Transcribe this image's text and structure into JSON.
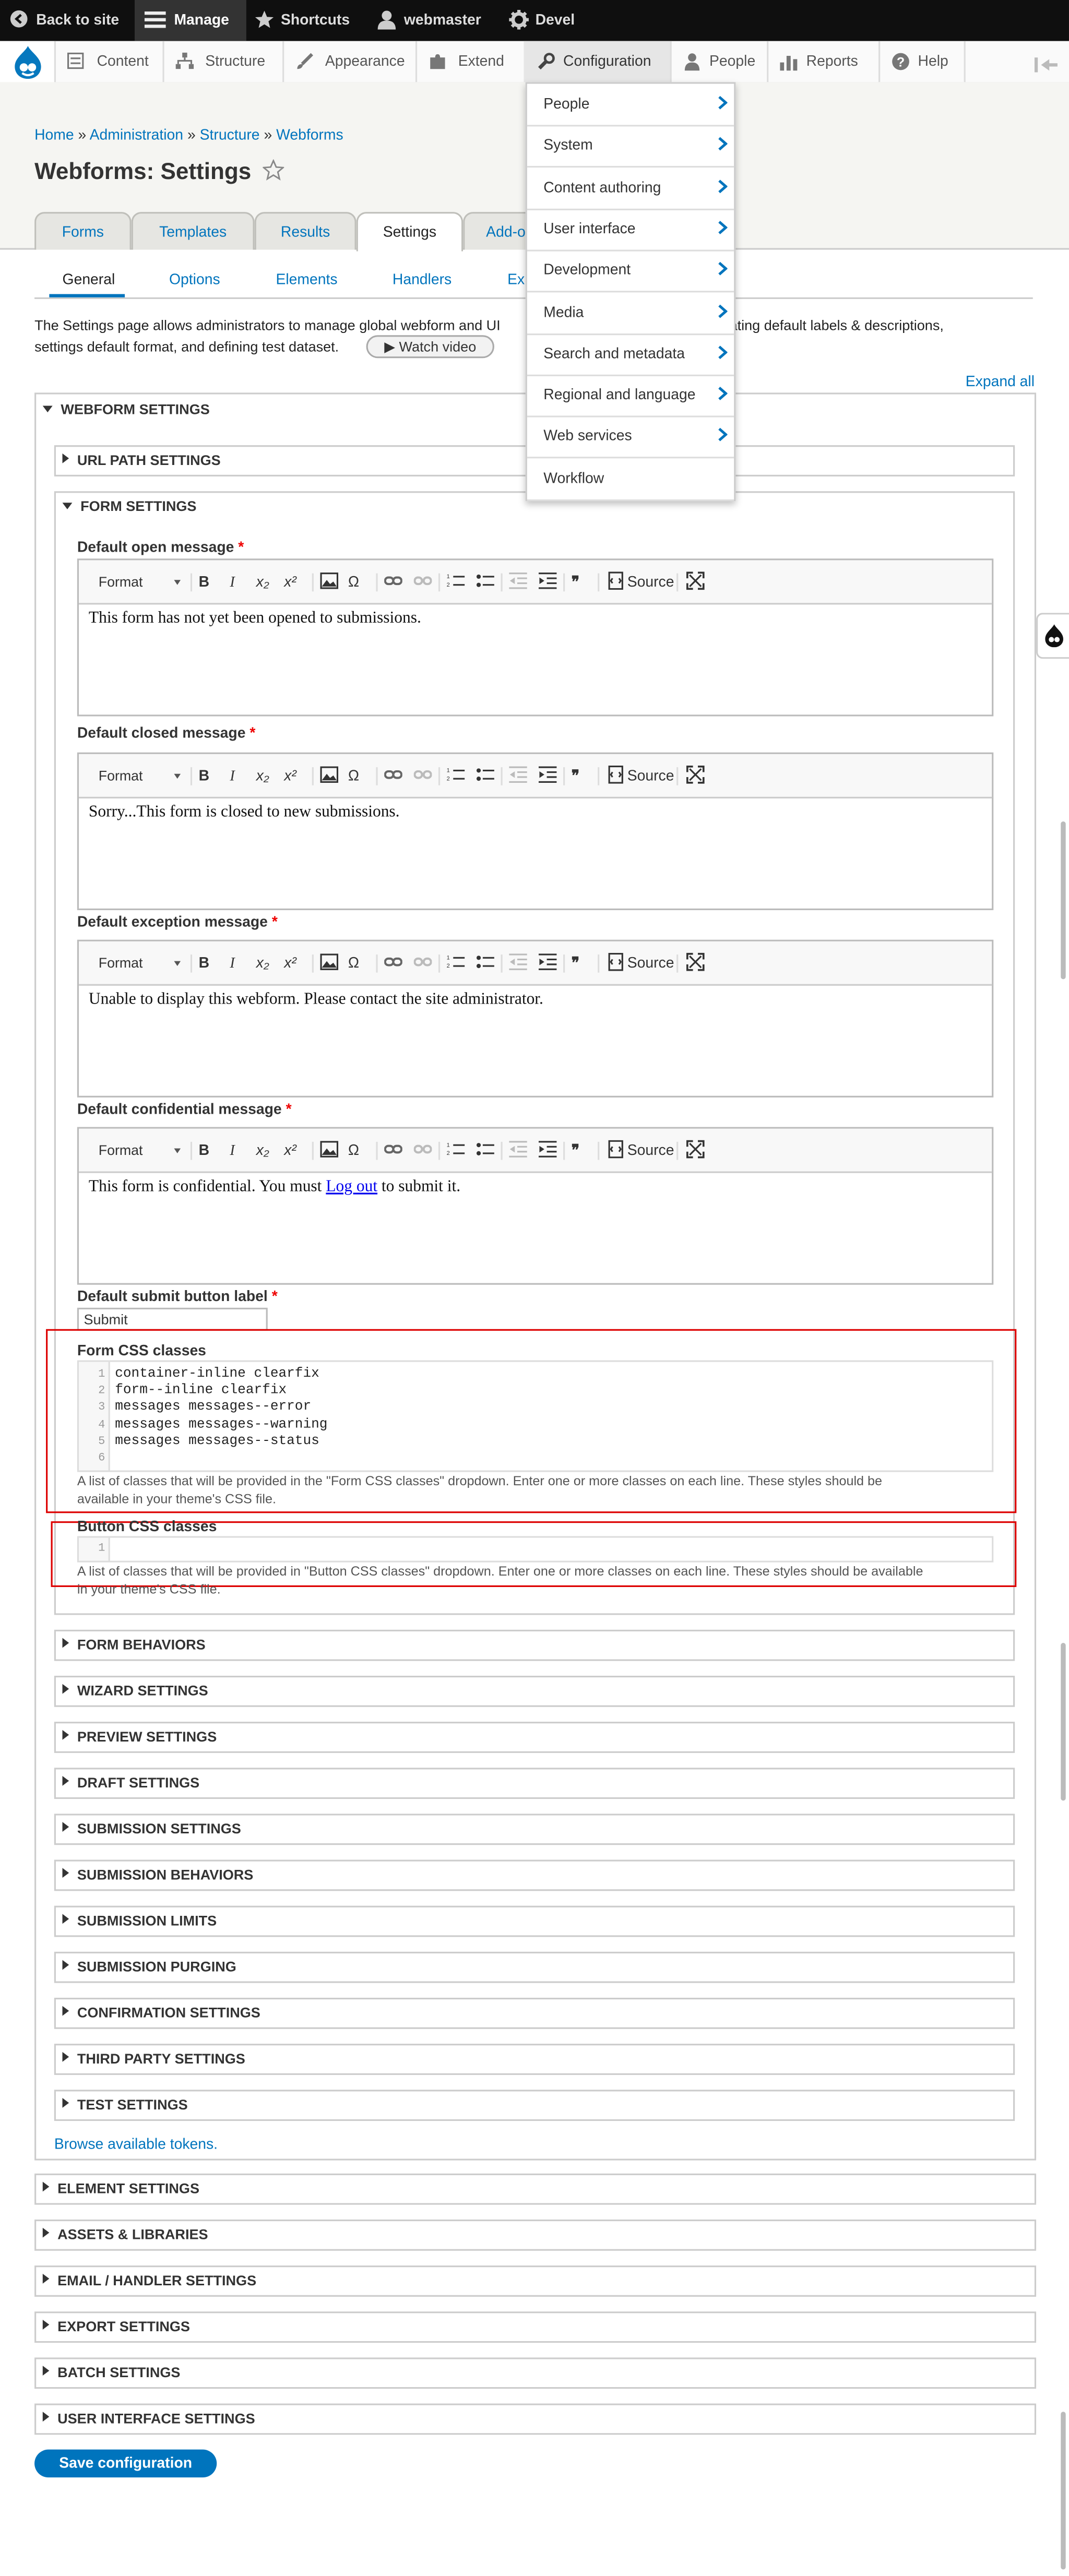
{
  "toolbar": {
    "back": "Back to site",
    "manage": "Manage",
    "shortcuts": "Shortcuts",
    "user": "webmaster",
    "devel": "Devel"
  },
  "tray": {
    "items": [
      "Content",
      "Structure",
      "Appearance",
      "Extend",
      "Configuration",
      "People",
      "Reports",
      "Help"
    ]
  },
  "config_menu": {
    "items": [
      "People",
      "System",
      "Content authoring",
      "User interface",
      "Development",
      "Media",
      "Search and metadata",
      "Regional and language",
      "Web services",
      "Workflow"
    ]
  },
  "breadcrumb": {
    "home": "Home",
    "admin": "Administration",
    "structure": "Structure",
    "webforms": "Webforms",
    "sep": "»"
  },
  "page": {
    "title": "Webforms: Settings"
  },
  "primary_tabs": [
    "Forms",
    "Templates",
    "Results",
    "Settings",
    "Add-o"
  ],
  "primary_tab_extra": "Ex",
  "secondary_tabs": [
    "General",
    "Options",
    "Elements",
    "Handlers"
  ],
  "intro": {
    "line1": "The Settings page allows administrators to manage global webform and UI",
    "line1b": "g updating default labels & descriptions,",
    "line2": "settings default format, and defining test dataset.",
    "watch_video": "▶ Watch video"
  },
  "expand_all": "Expand all",
  "webform_settings": {
    "title": "WEBFORM SETTINGS",
    "url_path": "URL PATH SETTINGS",
    "form_settings": "FORM SETTINGS",
    "fields": [
      {
        "label": "Default open message",
        "content": "This form has not yet been opened to submissions."
      },
      {
        "label": "Default closed message",
        "content": "Sorry...This form is closed to new submissions."
      },
      {
        "label": "Default exception message",
        "content": "Unable to display this webform. Please contact the site administrator."
      },
      {
        "label": "Default confidential message",
        "content_pre": "This form is confidential. You must ",
        "link": "Log out",
        "content_post": " to submit it."
      }
    ],
    "editor": {
      "format": "Format",
      "bold": "B",
      "italic": "I",
      "source": "Source",
      "omega": "Ω",
      "quote": "❞"
    },
    "submit_label": {
      "label": "Default submit button label",
      "value": "Submit"
    },
    "form_css": {
      "label": "Form CSS classes",
      "lines": [
        "container-inline clearfix",
        "form--inline clearfix",
        "messages messages--error",
        "messages messages--warning",
        "messages messages--status",
        ""
      ],
      "line_numbers": [
        "1",
        "2",
        "3",
        "4",
        "5",
        "6"
      ],
      "description_1": "A list of classes that will be provided in the \"Form CSS classes\" dropdown. Enter one or more classes on each line. These styles should be",
      "description_2": "available in your theme's CSS file."
    },
    "button_css": {
      "label": "Button CSS classes",
      "line_number": "1",
      "description_1": "A list of classes that will be provided in \"Button CSS classes\" dropdown. Enter one or more classes on each line. These styles should be available",
      "description_2": "in your theme's CSS file."
    },
    "subsections": [
      "FORM BEHAVIORS",
      "WIZARD SETTINGS",
      "PREVIEW SETTINGS",
      "DRAFT SETTINGS",
      "SUBMISSION SETTINGS",
      "SUBMISSION BEHAVIORS",
      "SUBMISSION LIMITS",
      "SUBMISSION PURGING",
      "CONFIRMATION SETTINGS",
      "THIRD PARTY SETTINGS",
      "TEST SETTINGS"
    ],
    "browse_tokens": "Browse available tokens."
  },
  "sections": [
    "ELEMENT SETTINGS",
    "ASSETS & LIBRARIES",
    "EMAIL / HANDLER SETTINGS",
    "EXPORT SETTINGS",
    "BATCH SETTINGS",
    "USER INTERFACE SETTINGS"
  ],
  "save": "Save configuration",
  "colors": {
    "link": "#0074bd",
    "required": "#e00",
    "highlight": "#d00",
    "toolbar": "#0f0f0f"
  }
}
